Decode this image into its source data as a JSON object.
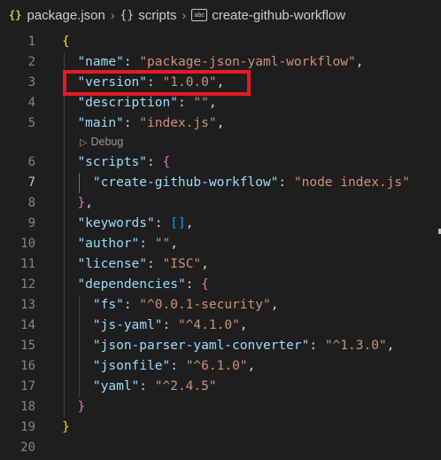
{
  "breadcrumb": {
    "file": "package.json",
    "file_icon": "json-braces-icon",
    "scripts": "scripts",
    "scripts_icon": "object-braces-icon",
    "item": "create-github-workflow",
    "item_icon": "string-abc-icon"
  },
  "lines": [
    {
      "n": "1",
      "t": "{"
    },
    {
      "n": "2",
      "k": "\"name\"",
      "v": "\"package-json-yaml-workflow\"",
      "e": ","
    },
    {
      "n": "3",
      "k": "\"version\"",
      "v": "\"1.0.0\"",
      "e": ","
    },
    {
      "n": "4",
      "k": "\"description\"",
      "v": "\"\"",
      "e": ","
    },
    {
      "n": "5",
      "k": "\"main\"",
      "v": "\"index.js\"",
      "e": ","
    },
    {
      "n": "6",
      "k": "\"scripts\"",
      "o": "{"
    },
    {
      "n": "7",
      "k": "\"create-github-workflow\"",
      "v": "\"node index.js\""
    },
    {
      "n": "8",
      "c": "}",
      "e": ","
    },
    {
      "n": "9",
      "k": "\"keywords\"",
      "a": "[]",
      "e": ","
    },
    {
      "n": "10",
      "k": "\"author\"",
      "v": "\"\"",
      "e": ","
    },
    {
      "n": "11",
      "k": "\"license\"",
      "v": "\"ISC\"",
      "e": ","
    },
    {
      "n": "12",
      "k": "\"dependencies\"",
      "o": "{"
    },
    {
      "n": "13",
      "k": "\"fs\"",
      "v": "\"^0.0.1-security\"",
      "e": ","
    },
    {
      "n": "14",
      "k": "\"js-yaml\"",
      "v": "\"^4.1.0\"",
      "e": ","
    },
    {
      "n": "15",
      "k": "\"json-parser-yaml-converter\"",
      "v": "\"^1.3.0\"",
      "e": ","
    },
    {
      "n": "16",
      "k": "\"jsonfile\"",
      "v": "\"^6.1.0\"",
      "e": ","
    },
    {
      "n": "17",
      "k": "\"yaml\"",
      "v": "\"^2.4.5\""
    },
    {
      "n": "18",
      "c": "}"
    },
    {
      "n": "19",
      "t": "}"
    },
    {
      "n": "20"
    }
  ],
  "codelens": {
    "label": "Debug",
    "icon": "play-icon"
  },
  "colors": {
    "background": "#1e1e1e",
    "key": "#9cdcfe",
    "string": "#ce9178",
    "highlight_box": "#e51b23"
  }
}
